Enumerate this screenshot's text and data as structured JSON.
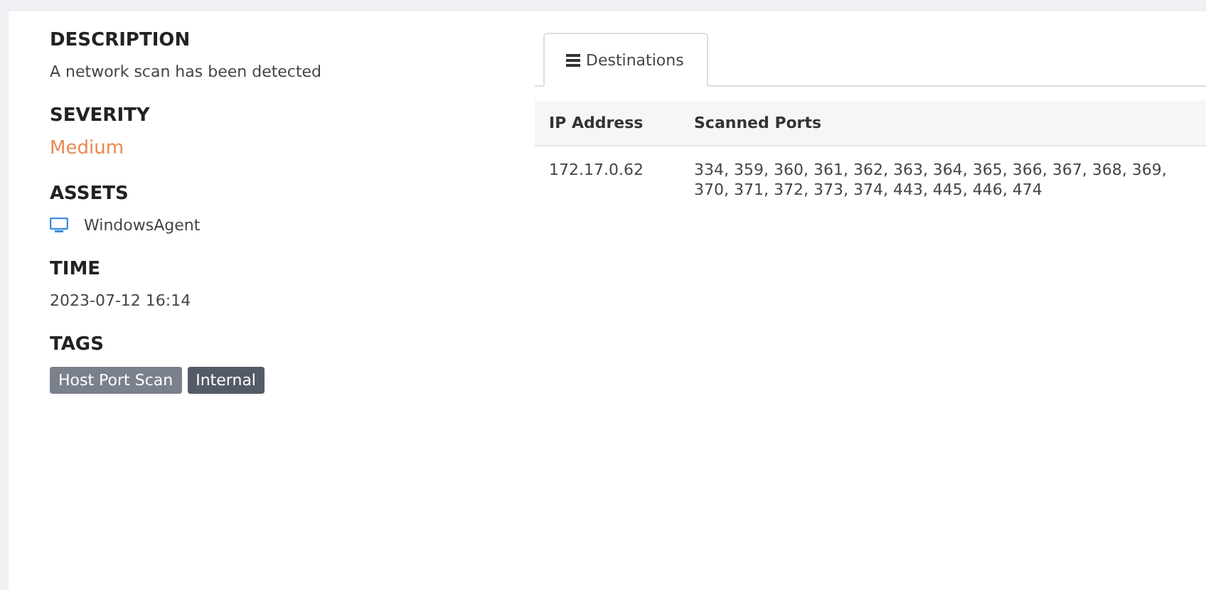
{
  "sections": [
    {
      "kind": "text",
      "heading": "DESCRIPTION",
      "value": "A network scan has been detected"
    },
    {
      "kind": "severity",
      "heading": "SEVERITY",
      "value": "Medium",
      "color": "#e8894f"
    },
    {
      "kind": "asset",
      "heading": "ASSETS",
      "value": "WindowsAgent"
    },
    {
      "kind": "text",
      "heading": "TIME",
      "value": "2023-07-12 16:14"
    },
    {
      "kind": "tags",
      "heading": "TAGS",
      "tags": [
        {
          "label": "Host Port Scan",
          "color": "#7a818c"
        },
        {
          "label": "Internal",
          "color": "#545b66"
        }
      ]
    }
  ],
  "tabs": [
    {
      "label": "Destinations",
      "selected": true
    }
  ],
  "table": {
    "columns": [
      "IP Address",
      "Scanned Ports"
    ],
    "rows": [
      [
        "172.17.0.62",
        "334, 359, 360, 361, 362, 363, 364, 365, 366, 367, 368, 369, 370, 371, 372, 373, 374, 443, 445, 446, 474"
      ]
    ]
  }
}
